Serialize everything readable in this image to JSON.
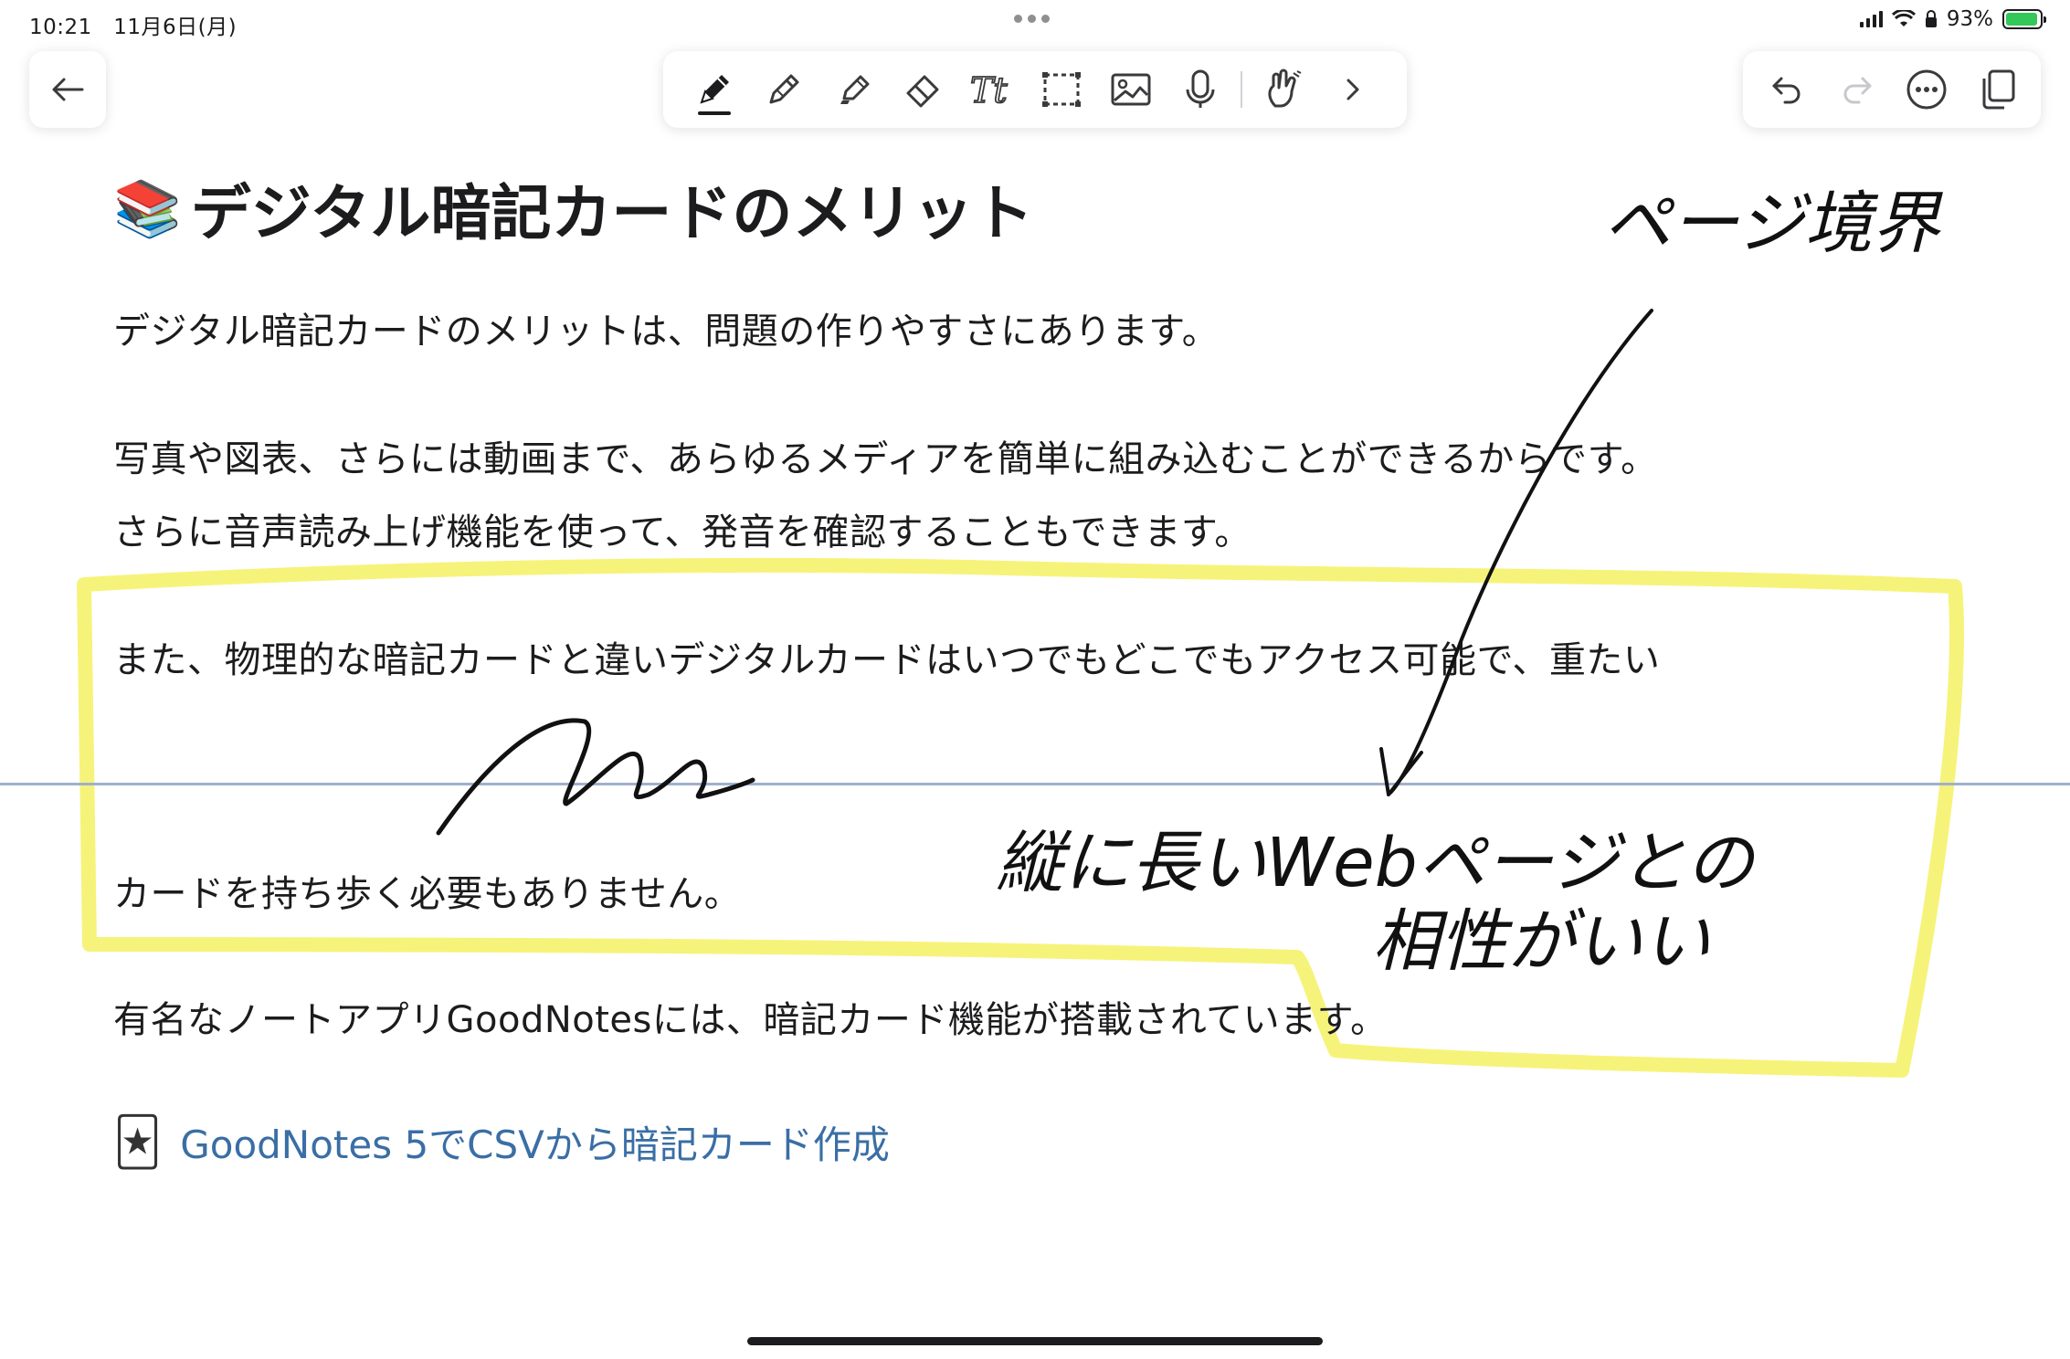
{
  "status_bar": {
    "time": "10:21",
    "date": "11月6日(月)",
    "battery_percent": "93%"
  },
  "toolbar": {
    "left": [
      {
        "icon": "back-arrow-icon",
        "label": "戻る"
      }
    ],
    "tools": [
      "pen-icon",
      "pencil-icon",
      "highlighter-icon",
      "eraser-icon",
      "text-tool-icon",
      "lasso-select-icon",
      "image-icon",
      "microphone-icon",
      "hand-gesture-icon",
      "chevron-right-icon"
    ],
    "active_tool": "pen-icon",
    "right": [
      "undo-icon",
      "redo-icon",
      "more-icon",
      "pages-icon"
    ]
  },
  "document": {
    "title_emoji": "📚",
    "title": "デジタル暗記カードのメリット",
    "paragraphs": [
      "デジタル暗記カードのメリットは、問題の作りやすさにあります。",
      "写真や図表、さらには動画まで、あらゆるメディアを簡単に組み込むことができるからです。",
      "さらに音声読み上げ機能を使って、発音を確認することもできます。",
      "また、物理的な暗記カードと違いデジタルカードはいつでもどこでもアクセス可能で、重たい",
      "カードを持ち歩く必要もありません。",
      "有名なノートアプリGoodNotesには、暗記カード機能が搭載されています。"
    ],
    "link": {
      "emoji": "🃏",
      "text": "GoodNotes 5でCSVから暗記カード作成"
    }
  },
  "annotations": {
    "handwriting_top": "ページ境界",
    "handwriting_bottom_line1": "縦に長いWebページとの",
    "handwriting_bottom_line2": "相性がいい",
    "highlight_color": "#f6f37a",
    "ink_color": "#111111"
  },
  "colors": {
    "link": "#3a6ea5",
    "page_divider": "#9db1cc",
    "battery_fill": "#34c759"
  }
}
